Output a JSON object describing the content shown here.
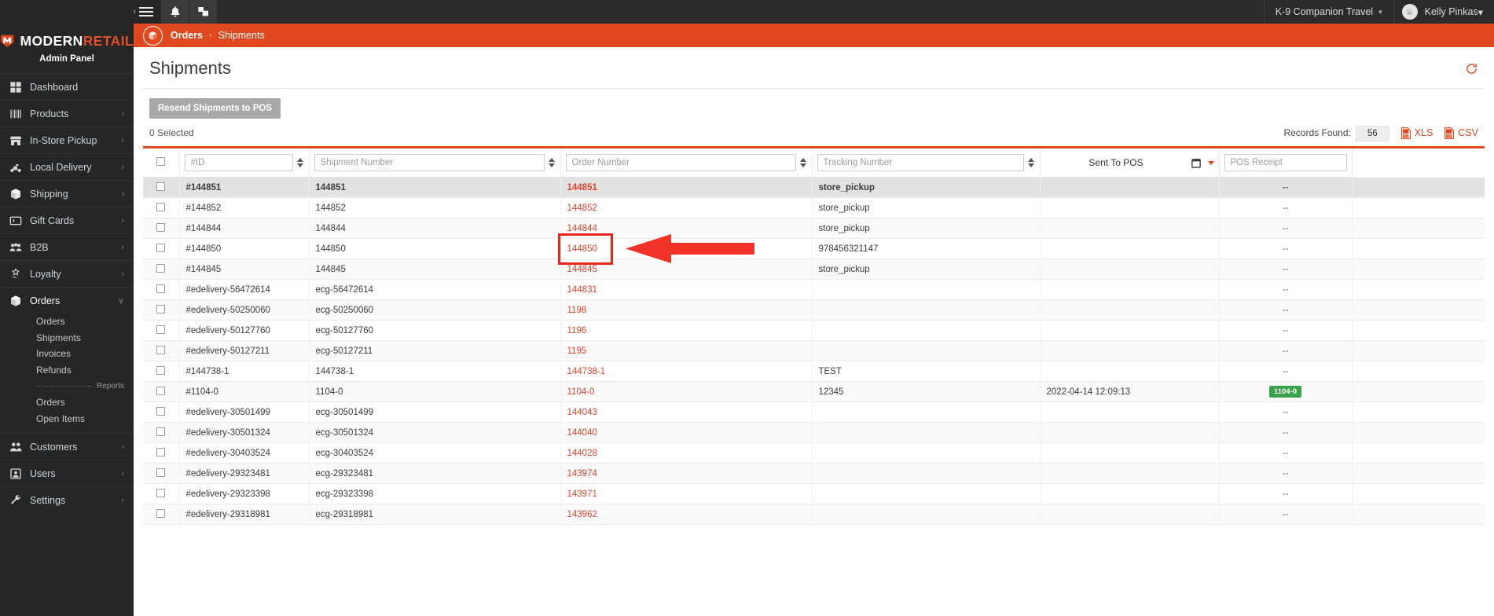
{
  "topbar": {
    "menu_icon": "hamburger-icon",
    "collapse_icon": "chevron-left-icon",
    "notifications_icon": "bell-icon",
    "apps_icon": "windows-icon",
    "account_label": "K-9 Companion Travel",
    "user_label": "Kelly Pinkas",
    "caret": "▾"
  },
  "sidebar": {
    "brand_word1": "MODERN",
    "brand_word2": "RETAIL",
    "brand_sub": "Admin Panel",
    "items": [
      {
        "label": "Dashboard",
        "icon": "dashboard-icon",
        "arrow": ""
      },
      {
        "label": "Products",
        "icon": "barcode-icon",
        "arrow": "›"
      },
      {
        "label": "In-Store Pickup",
        "icon": "store-icon",
        "arrow": "›"
      },
      {
        "label": "Local Delivery",
        "icon": "scooter-icon",
        "arrow": "›"
      },
      {
        "label": "Shipping",
        "icon": "box-icon",
        "arrow": "›"
      },
      {
        "label": "Gift Cards",
        "icon": "giftcard-icon",
        "arrow": "›"
      },
      {
        "label": "B2B",
        "icon": "users-group-icon",
        "arrow": "›"
      },
      {
        "label": "Loyalty",
        "icon": "loyalty-hand-icon",
        "arrow": "›"
      },
      {
        "label": "Orders",
        "icon": "box-icon",
        "arrow": "∨"
      }
    ],
    "orders_sub": [
      {
        "label": "Orders"
      },
      {
        "label": "Shipments"
      },
      {
        "label": "Invoices"
      },
      {
        "label": "Refunds"
      }
    ],
    "reports_divider": "Reports",
    "orders_reports": [
      {
        "label": "Orders"
      },
      {
        "label": "Open Items"
      }
    ],
    "items_bottom": [
      {
        "label": "Customers",
        "icon": "customers-icon",
        "arrow": "›"
      },
      {
        "label": "Users",
        "icon": "user-card-icon",
        "arrow": "›"
      },
      {
        "label": "Settings",
        "icon": "wrench-icon",
        "arrow": "›"
      }
    ]
  },
  "breadcrumb": {
    "icon": "box-circle-icon",
    "parent": "Orders",
    "separator": "›",
    "current": "Shipments"
  },
  "page": {
    "title": "Shipments",
    "refresh_icon": "refresh-icon",
    "resend_button": "Resend Shipments to POS",
    "selected_text": "0 Selected",
    "records_label": "Records Found:",
    "records_count": "56",
    "export_xls": "XLS",
    "export_csv": "CSV",
    "xls_icon": "xls-file-icon",
    "csv_icon": "csv-file-icon"
  },
  "table": {
    "select_all_checkbox": "select-all-checkbox",
    "columns": [
      {
        "key": "id",
        "placeholder": "#ID",
        "type": "filter",
        "sortable": true
      },
      {
        "key": "shipment_number",
        "placeholder": "Shipment Number",
        "type": "filter",
        "sortable": true
      },
      {
        "key": "order_number",
        "placeholder": "Order Number",
        "type": "filter",
        "sortable": true
      },
      {
        "key": "tracking_number",
        "placeholder": "Tracking Number",
        "type": "filter",
        "sortable": true
      },
      {
        "key": "sent_to_pos",
        "label": "Sent To POS",
        "type": "date",
        "sortable": false
      },
      {
        "key": "pos_receipt",
        "placeholder": "POS Receipt",
        "type": "filter",
        "sortable": false
      }
    ],
    "rows": [
      {
        "id": "#144851",
        "shipment_number": "144851",
        "order_number": "144851",
        "tracking_number": "store_pickup",
        "sent_to_pos": "",
        "pos_receipt": "--",
        "highlight_row": true
      },
      {
        "id": "#144852",
        "shipment_number": "144852",
        "order_number": "144852",
        "tracking_number": "store_pickup",
        "sent_to_pos": "",
        "pos_receipt": "--"
      },
      {
        "id": "#144844",
        "shipment_number": "144844",
        "order_number": "144844",
        "tracking_number": "store_pickup",
        "sent_to_pos": "",
        "pos_receipt": "--"
      },
      {
        "id": "#144850",
        "shipment_number": "144850",
        "order_number": "144850",
        "tracking_number": "978456321147",
        "sent_to_pos": "",
        "pos_receipt": "--",
        "annotated": true
      },
      {
        "id": "#144845",
        "shipment_number": "144845",
        "order_number": "144845",
        "tracking_number": "store_pickup",
        "sent_to_pos": "",
        "pos_receipt": "--"
      },
      {
        "id": "#edelivery-56472614",
        "shipment_number": "ecg-56472614",
        "order_number": "144831",
        "tracking_number": "",
        "sent_to_pos": "",
        "pos_receipt": "--"
      },
      {
        "id": "#edelivery-50250060",
        "shipment_number": "ecg-50250060",
        "order_number": "1198",
        "tracking_number": "",
        "sent_to_pos": "",
        "pos_receipt": "--"
      },
      {
        "id": "#edelivery-50127760",
        "shipment_number": "ecg-50127760",
        "order_number": "1196",
        "tracking_number": "",
        "sent_to_pos": "",
        "pos_receipt": "--"
      },
      {
        "id": "#edelivery-50127211",
        "shipment_number": "ecg-50127211",
        "order_number": "1195",
        "tracking_number": "",
        "sent_to_pos": "",
        "pos_receipt": "--"
      },
      {
        "id": "#144738-1",
        "shipment_number": "144738-1",
        "order_number": "144738-1",
        "tracking_number": "TEST",
        "sent_to_pos": "",
        "pos_receipt": "--"
      },
      {
        "id": "#1104-0",
        "shipment_number": "1104-0",
        "order_number": "1104-0",
        "tracking_number": "12345",
        "sent_to_pos": "2022-04-14 12:09:13",
        "pos_receipt": "1104-0",
        "pos_receipt_badge": true
      },
      {
        "id": "#edelivery-30501499",
        "shipment_number": "ecg-30501499",
        "order_number": "144043",
        "tracking_number": "",
        "sent_to_pos": "",
        "pos_receipt": "--"
      },
      {
        "id": "#edelivery-30501324",
        "shipment_number": "ecg-30501324",
        "order_number": "144040",
        "tracking_number": "",
        "sent_to_pos": "",
        "pos_receipt": "--"
      },
      {
        "id": "#edelivery-30403524",
        "shipment_number": "ecg-30403524",
        "order_number": "144028",
        "tracking_number": "",
        "sent_to_pos": "",
        "pos_receipt": "--"
      },
      {
        "id": "#edelivery-29323481",
        "shipment_number": "ecg-29323481",
        "order_number": "143974",
        "tracking_number": "",
        "sent_to_pos": "",
        "pos_receipt": "--"
      },
      {
        "id": "#edelivery-29323398",
        "shipment_number": "ecg-29323398",
        "order_number": "143971",
        "tracking_number": "",
        "sent_to_pos": "",
        "pos_receipt": "--"
      },
      {
        "id": "#edelivery-29318981",
        "shipment_number": "ecg-29318981",
        "order_number": "143962",
        "tracking_number": "",
        "sent_to_pos": "",
        "pos_receipt": "--"
      }
    ]
  },
  "annotation": {
    "type": "red-box-and-arrow",
    "target_cell": "144850",
    "box_color": "#e8251b",
    "arrow_color": "#f03228"
  },
  "colors": {
    "brand_orange": "#e0491f",
    "sidebar_dark": "#262626",
    "topbar_dark": "#2b2b2b",
    "link_red": "#d9442c",
    "badge_green": "#38a34a"
  }
}
